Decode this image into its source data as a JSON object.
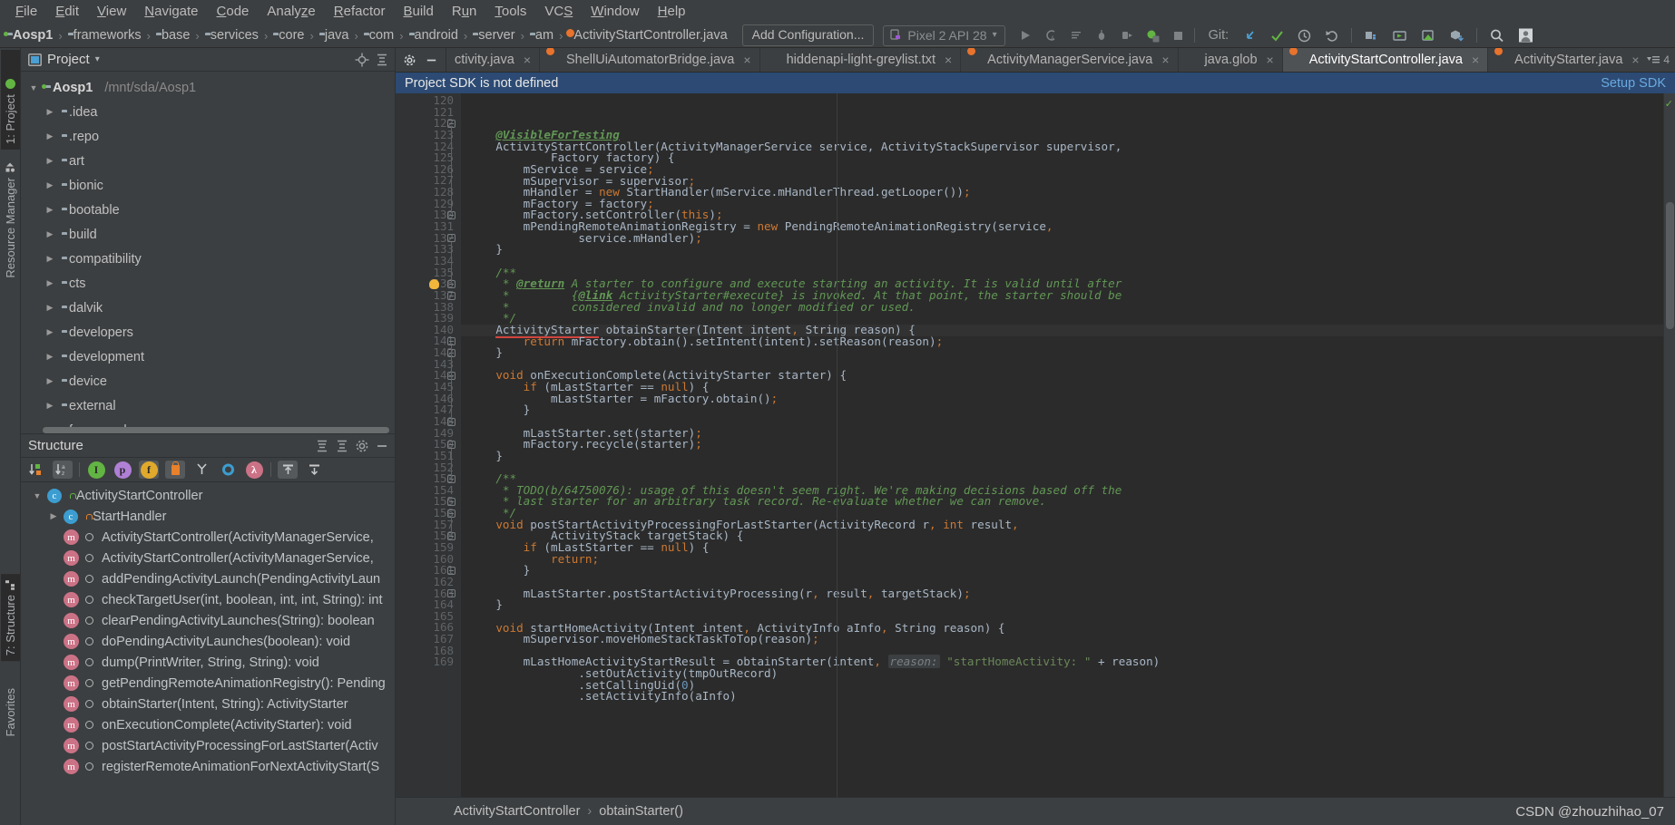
{
  "menubar": {
    "items": [
      {
        "label": "File",
        "mnemonic": "F"
      },
      {
        "label": "Edit",
        "mnemonic": "E"
      },
      {
        "label": "View",
        "mnemonic": "V"
      },
      {
        "label": "Navigate",
        "mnemonic": "N"
      },
      {
        "label": "Code",
        "mnemonic": "C"
      },
      {
        "label": "Analyze",
        "mnemonic": "z"
      },
      {
        "label": "Refactor",
        "mnemonic": "R"
      },
      {
        "label": "Build",
        "mnemonic": "B"
      },
      {
        "label": "Run",
        "mnemonic": "u"
      },
      {
        "label": "Tools",
        "mnemonic": "T"
      },
      {
        "label": "VCS",
        "mnemonic": "S"
      },
      {
        "label": "Window",
        "mnemonic": "W"
      },
      {
        "label": "Help",
        "mnemonic": "H"
      }
    ]
  },
  "navbar": {
    "breadcrumbs": [
      {
        "label": "Aosp1",
        "icon": "project-folder-icon"
      },
      {
        "label": "frameworks",
        "icon": "folder-icon"
      },
      {
        "label": "base",
        "icon": "folder-icon"
      },
      {
        "label": "services",
        "icon": "folder-icon"
      },
      {
        "label": "core",
        "icon": "folder-icon"
      },
      {
        "label": "java",
        "icon": "folder-icon"
      },
      {
        "label": "com",
        "icon": "folder-icon"
      },
      {
        "label": "android",
        "icon": "folder-icon"
      },
      {
        "label": "server",
        "icon": "folder-icon"
      },
      {
        "label": "am",
        "icon": "folder-icon"
      },
      {
        "label": "ActivityStartController.java",
        "icon": "java-file-icon"
      }
    ],
    "separator": "›",
    "add_configuration_label": "Add Configuration...",
    "device_label": "Pixel 2 API 28",
    "device_caret": "▾",
    "git_label": "Git:",
    "run_icons": [
      "run-icon",
      "run-coverage-icon",
      "profile-icon",
      "debug-icon",
      "attach-debugger-icon",
      "android-device-monitor-icon",
      "stop-icon"
    ],
    "git_icons": [
      "update-project-icon",
      "commit-icon",
      "history-icon",
      "rollback-icon"
    ],
    "right_icons": [
      "sdk-manager-icon",
      "avd-manager-icon",
      "run-device-icon",
      "sync-gradle-icon",
      "search-icon",
      "avatar-icon"
    ]
  },
  "left_stripe": {
    "project": "1: Project",
    "resource_manager": "Resource Manager",
    "structure": "7: Structure",
    "favorites": "Favorites"
  },
  "project_panel": {
    "title": "Project",
    "title_caret": "▾",
    "header_icons": [
      "locate-icon",
      "collapse-all-icon",
      "settings-icon",
      "hide-icon"
    ],
    "tree": [
      {
        "label": "Aosp1",
        "sub": "/mnt/sda/Aosp1",
        "expanded": true,
        "depth": 0,
        "icon": "project-folder-icon",
        "bold": true
      },
      {
        "label": ".idea",
        "expanded": false,
        "depth": 1,
        "icon": "folder-icon"
      },
      {
        "label": ".repo",
        "expanded": false,
        "depth": 1,
        "icon": "folder-icon"
      },
      {
        "label": "art",
        "expanded": false,
        "depth": 1,
        "icon": "folder-icon"
      },
      {
        "label": "bionic",
        "expanded": false,
        "depth": 1,
        "icon": "folder-icon"
      },
      {
        "label": "bootable",
        "expanded": false,
        "depth": 1,
        "icon": "folder-icon"
      },
      {
        "label": "build",
        "expanded": false,
        "depth": 1,
        "icon": "folder-icon"
      },
      {
        "label": "compatibility",
        "expanded": false,
        "depth": 1,
        "icon": "folder-icon"
      },
      {
        "label": "cts",
        "expanded": false,
        "depth": 1,
        "icon": "folder-icon"
      },
      {
        "label": "dalvik",
        "expanded": false,
        "depth": 1,
        "icon": "folder-icon"
      },
      {
        "label": "developers",
        "expanded": false,
        "depth": 1,
        "icon": "folder-icon"
      },
      {
        "label": "development",
        "expanded": false,
        "depth": 1,
        "icon": "folder-icon"
      },
      {
        "label": "device",
        "expanded": false,
        "depth": 1,
        "icon": "folder-icon"
      },
      {
        "label": "external",
        "expanded": false,
        "depth": 1,
        "icon": "folder-icon"
      },
      {
        "label": "frameworks",
        "expanded": false,
        "depth": 1,
        "icon": "folder-icon"
      }
    ]
  },
  "structure_panel": {
    "title": "Structure",
    "header_icons": [
      "expand-all-icon",
      "collapse-all-icon",
      "settings-icon",
      "hide-icon"
    ],
    "toolbar_icons": [
      {
        "name": "sort-by-visibility-icon",
        "on": false
      },
      {
        "name": "sort-alphabetically-icon",
        "on": true
      },
      {
        "name": "show-inherited-icon",
        "on": false
      },
      {
        "name": "show-properties-icon",
        "on": false
      },
      {
        "name": "show-fields-icon",
        "on": true
      },
      {
        "name": "show-non-public-icon",
        "on": true
      },
      {
        "name": "group-by-icon",
        "on": false
      },
      {
        "name": "show-anonymous-icon",
        "on": false
      },
      {
        "name": "show-lambdas-icon",
        "on": false
      },
      {
        "name": "expand-all-icon",
        "on": true
      },
      {
        "name": "collapse-all-icon",
        "on": false
      }
    ],
    "tree": [
      {
        "label": "ActivityStartController",
        "depth": 0,
        "expanded": true,
        "icon": "class-icon",
        "badge": "public-lock-green"
      },
      {
        "label": "StartHandler",
        "depth": 1,
        "expanded": false,
        "icon": "class-icon",
        "badge": "private-lock-orange"
      },
      {
        "label": "ActivityStartController(ActivityManagerService,",
        "depth": 1,
        "icon": "method-icon",
        "badge": "public-circle"
      },
      {
        "label": "ActivityStartController(ActivityManagerService,",
        "depth": 1,
        "icon": "method-icon",
        "badge": "public-circle"
      },
      {
        "label": "addPendingActivityLaunch(PendingActivityLaun",
        "depth": 1,
        "icon": "method-icon",
        "badge": "public-circle"
      },
      {
        "label": "checkTargetUser(int, boolean, int, int, String): int",
        "depth": 1,
        "icon": "method-icon",
        "badge": "public-circle"
      },
      {
        "label": "clearPendingActivityLaunches(String): boolean",
        "depth": 1,
        "icon": "method-icon",
        "badge": "public-circle"
      },
      {
        "label": "doPendingActivityLaunches(boolean): void",
        "depth": 1,
        "icon": "method-icon",
        "badge": "public-circle"
      },
      {
        "label": "dump(PrintWriter, String, String): void",
        "depth": 1,
        "icon": "method-icon",
        "badge": "public-circle"
      },
      {
        "label": "getPendingRemoteAnimationRegistry(): Pending",
        "depth": 1,
        "icon": "method-icon",
        "badge": "public-circle"
      },
      {
        "label": "obtainStarter(Intent, String): ActivityStarter",
        "depth": 1,
        "icon": "method-icon",
        "badge": "public-circle"
      },
      {
        "label": "onExecutionComplete(ActivityStarter): void",
        "depth": 1,
        "icon": "method-icon",
        "badge": "public-circle"
      },
      {
        "label": "postStartActivityProcessingForLastStarter(Activ",
        "depth": 1,
        "icon": "method-icon",
        "badge": "public-circle"
      },
      {
        "label": "registerRemoteAnimationForNextActivityStart(S",
        "depth": 1,
        "icon": "method-icon",
        "badge": "public-circle"
      }
    ]
  },
  "editor": {
    "tabs": [
      {
        "label": "ctivity.java",
        "icon": "java-file-icon",
        "active": false,
        "closable": true,
        "truncated": true
      },
      {
        "label": "ShellUiAutomatorBridge.java",
        "icon": "java-file-icon",
        "active": false,
        "closable": true
      },
      {
        "label": "hiddenapi-light-greylist.txt",
        "icon": "text-file-icon",
        "active": false,
        "closable": true
      },
      {
        "label": "ActivityManagerService.java",
        "icon": "java-file-icon",
        "active": false,
        "closable": true
      },
      {
        "label": "java.glob",
        "icon": "text-file-icon",
        "active": false,
        "closable": true
      },
      {
        "label": "ActivityStartController.java",
        "icon": "java-file-icon",
        "active": true,
        "closable": true
      },
      {
        "label": "ActivityStarter.java",
        "icon": "java-file-icon",
        "active": false,
        "closable": true
      }
    ],
    "tab_overflow_label": "4",
    "tab_close_glyph": "×",
    "notification": {
      "message": "Project SDK is not defined",
      "action": "Setup SDK"
    },
    "first_line_number": 120,
    "lines": [
      {
        "n": 120,
        "html": "    <span class=\"tag\">@VisibleForTesting</span>"
      },
      {
        "n": 121,
        "html": "    ActivityStartController(ActivityManagerService service, ActivityStackSupervisor supervisor,"
      },
      {
        "n": 122,
        "html": "            Factory factory) {",
        "fold": true
      },
      {
        "n": 123,
        "html": "        mService = service<span class=\"semi\">;</span>"
      },
      {
        "n": 124,
        "html": "        mSupervisor = supervisor<span class=\"semi\">;</span>"
      },
      {
        "n": 125,
        "html": "        mHandler = <span class=\"kw\">new </span>StartHandler(mService.mHandlerThread.getLooper())<span class=\"semi\">;</span>"
      },
      {
        "n": 126,
        "html": "        mFactory = factory<span class=\"semi\">;</span>"
      },
      {
        "n": 127,
        "html": "        mFactory.setController(<span class=\"kw\">this</span>)<span class=\"semi\">;</span>"
      },
      {
        "n": 128,
        "html": "        mPendingRemoteAnimationRegistry = <span class=\"kw\">new </span>PendingRemoteAnimationRegistry(service<span class=\"semi\">,</span>"
      },
      {
        "n": 129,
        "html": "                service.mHandler)<span class=\"semi\">;</span>"
      },
      {
        "n": 130,
        "html": "    }",
        "fold": true
      },
      {
        "n": 131,
        "html": ""
      },
      {
        "n": 132,
        "html": "    <span class=\"cmt\">/**</span>",
        "fold": true
      },
      {
        "n": 133,
        "html": "     <span class=\"cmt\">* </span><span class=\"tag\">@return</span><span class=\"cmt\"> A starter to configure and execute starting an activity. It is valid until after</span>"
      },
      {
        "n": 134,
        "html": "     <span class=\"cmt\">*         {</span><span class=\"tag\">@link</span><span class=\"cmt\"> ActivityStarter#execute} is invoked. At that point, the starter should be</span>"
      },
      {
        "n": 135,
        "html": "     <span class=\"cmt\">*         considered invalid and no longer modified or used.</span>"
      },
      {
        "n": 136,
        "html": "     <span class=\"cmt\">*/</span>",
        "fold": true,
        "bulb": true
      },
      {
        "n": 137,
        "html": "    <span class=\"err-underline\">ActivityStarter</span> obtainStarter(Intent intent<span class=\"semi\">,</span> String reason) {",
        "fold": true,
        "current": true
      },
      {
        "n": 138,
        "html": "        <span class=\"kw\">return </span>mFactory.obtain().setIntent(intent).setReason(reason)<span class=\"semi\">;</span>"
      },
      {
        "n": 139,
        "html": "    }"
      },
      {
        "n": 140,
        "html": ""
      },
      {
        "n": 141,
        "html": "    <span class=\"kw\">void </span>onExecutionComplete(ActivityStarter starter) {",
        "fold": true
      },
      {
        "n": 142,
        "html": "        <span class=\"kw\">if </span>(mLastStarter == <span class=\"kw\">null</span>) {",
        "fold": true
      },
      {
        "n": 143,
        "html": "            mLastStarter = mFactory.obtain()<span class=\"semi\">;</span>"
      },
      {
        "n": 144,
        "html": "        }",
        "fold": true
      },
      {
        "n": 145,
        "html": ""
      },
      {
        "n": 146,
        "html": "        mLastStarter.set(starter)<span class=\"semi\">;</span>"
      },
      {
        "n": 147,
        "html": "        mFactory.recycle(starter)<span class=\"semi\">;</span>"
      },
      {
        "n": 148,
        "html": "    }",
        "fold": true
      },
      {
        "n": 149,
        "html": ""
      },
      {
        "n": 150,
        "html": "    <span class=\"cmt\">/**</span>",
        "fold": true
      },
      {
        "n": 151,
        "html": "     <span class=\"cmt\">* TODO(b/64750076): usage of this doesn't seem right. We're making decisions based off the</span>"
      },
      {
        "n": 152,
        "html": "     <span class=\"cmt\">* last starter for an arbitrary task record. Re-evaluate whether we can remove.</span>"
      },
      {
        "n": 153,
        "html": "     <span class=\"cmt\">*/</span>",
        "fold": true
      },
      {
        "n": 154,
        "html": "    <span class=\"kw\">void </span>postStartActivityProcessingForLastStarter(ActivityRecord r<span class=\"semi\">, </span><span class=\"kw\">int </span>result<span class=\"semi\">,</span>"
      },
      {
        "n": 155,
        "html": "            ActivityStack targetStack) {",
        "fold": true
      },
      {
        "n": 156,
        "html": "        <span class=\"kw\">if </span>(mLastStarter == <span class=\"kw\">null</span>) {",
        "fold": true
      },
      {
        "n": 157,
        "html": "            <span class=\"kw\">return</span><span class=\"semi\">;</span>"
      },
      {
        "n": 158,
        "html": "        }",
        "fold": true
      },
      {
        "n": 159,
        "html": ""
      },
      {
        "n": 160,
        "html": "        mLastStarter.postStartActivityProcessing(r<span class=\"semi\">, </span>result<span class=\"semi\">, </span>targetStack)<span class=\"semi\">;</span>"
      },
      {
        "n": 161,
        "html": "    }",
        "fold": true
      },
      {
        "n": 162,
        "html": ""
      },
      {
        "n": 163,
        "html": "    <span class=\"kw\">void </span>startHomeActivity(Intent intent<span class=\"semi\">,</span> ActivityInfo aInfo<span class=\"semi\">,</span> String reason) {",
        "fold": true
      },
      {
        "n": 164,
        "html": "        mSupervisor.moveHomeStackTaskToTop(reason)<span class=\"semi\">;</span>"
      },
      {
        "n": 165,
        "html": ""
      },
      {
        "n": 166,
        "html": "        mLastHomeActivityStartResult = obtainStarter(intent<span class=\"semi\">, </span><span class=\"hint\">reason:</span> <span class=\"str\">\"startHomeActivity: \" </span>+ reason)"
      },
      {
        "n": 167,
        "html": "                .setOutActivity(tmpOutRecord)"
      },
      {
        "n": 168,
        "html": "                .setCallingUid(<span class=\"num\">0</span>)"
      },
      {
        "n": 169,
        "html": "                .setActivityInfo(aInfo)"
      }
    ]
  },
  "status_breadcrumb": {
    "parts": [
      "ActivityStartController",
      "obtainStarter()"
    ],
    "separator": "›"
  },
  "watermark": "CSDN @zhouzhihao_07",
  "colors": {
    "accent_blue": "#2c4a73",
    "link_blue": "#6aa9e0",
    "green": "#62b543",
    "orange": "#e8812c",
    "editor_bg": "#2b2b2b",
    "panel_bg": "#3c3f41",
    "gutter_bg": "#313335",
    "selection": "#4e5254",
    "error_red": "#d1443e",
    "string_green": "#6a8759",
    "keyword_orange": "#cc7832",
    "comment_green": "#629755"
  }
}
